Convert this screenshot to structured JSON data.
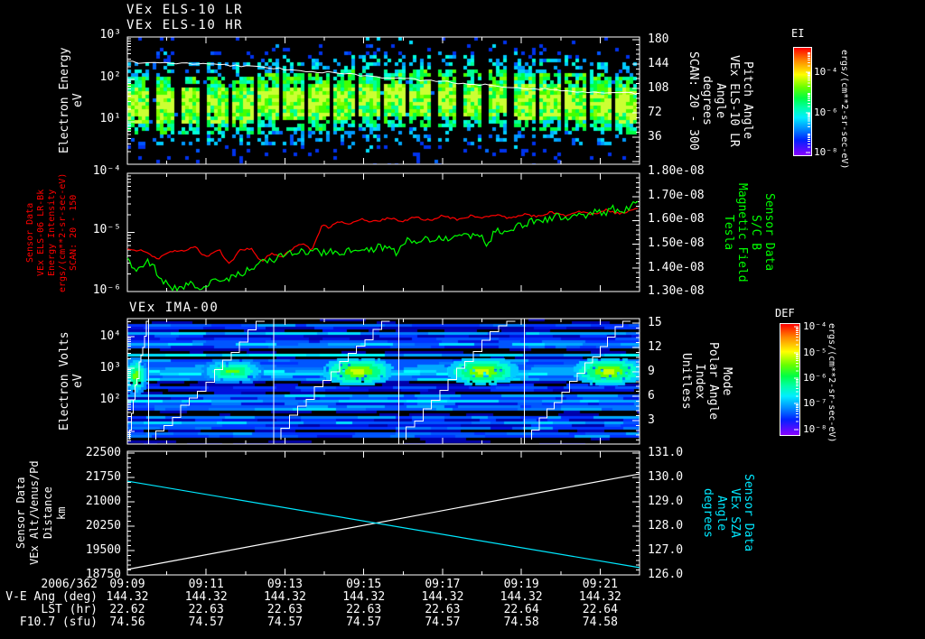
{
  "header": {
    "title_line1": "VEx ELS-10 LR",
    "title_line2": "VEx ELS-10 HR"
  },
  "panel1": {
    "left_label_lines": [
      "Electron Energy",
      "eV"
    ],
    "left_ticks": [
      "10³",
      "10²",
      "10¹"
    ],
    "right_ticks": [
      "180",
      "144",
      "108",
      "72",
      "36"
    ],
    "right_label_lines": [
      "Pitch Angle",
      "VEx ELS-10 LR",
      "Angle",
      "degrees",
      "SCAN: 20 - 300"
    ],
    "colorbar": {
      "title": "EI",
      "ticks": [
        "10⁻⁴",
        "10⁻⁶",
        "10⁻⁸"
      ],
      "units": "ergs/(cm**2-sr-sec-eV)"
    }
  },
  "panel2": {
    "left_label_lines": [
      "Sensor Data",
      "VEx ELS-06 LR-Bk",
      "Energy Intensity",
      "ergs/(cm**2-sr-sec-eV)",
      "SCAN: 20 - 150"
    ],
    "left_ticks": [
      "10⁻⁴",
      "10⁻⁵",
      "10⁻⁶"
    ],
    "right_ticks": [
      "1.80e-08",
      "1.70e-08",
      "1.60e-08",
      "1.50e-08",
      "1.40e-08",
      "1.30e-08"
    ],
    "right_label_lines": [
      "Sensor Data",
      "S/C B",
      "Magnetic Field",
      "Tesla"
    ]
  },
  "panel3": {
    "title": "VEx IMA-00",
    "left_label_lines": [
      "Electron Volts",
      "eV"
    ],
    "left_ticks": [
      "10⁴",
      "10³",
      "10²"
    ],
    "right_ticks": [
      "15",
      "12",
      "9",
      "6",
      "3"
    ],
    "right_label_lines": [
      "Mode",
      "Polar Angle",
      "Index",
      "Unitless"
    ],
    "colorbar": {
      "title": "DEF",
      "ticks": [
        "10⁻⁴",
        "10⁻⁵",
        "10⁻⁶",
        "10⁻⁷",
        "10⁻⁸"
      ],
      "units": "ergs/(cm**2-sr-sec-eV)"
    }
  },
  "panel4": {
    "left_label_lines": [
      "Sensor Data",
      "VEx Alt/Venus/Pd",
      "Distance",
      "km"
    ],
    "left_ticks": [
      "22500",
      "21750",
      "21000",
      "20250",
      "19500",
      "18750"
    ],
    "right_ticks": [
      "131.0",
      "130.0",
      "129.0",
      "128.0",
      "127.0",
      "126.0"
    ],
    "right_label_lines": [
      "Sensor Data",
      "VEx SZA",
      "Angle",
      "degrees"
    ]
  },
  "xaxis": {
    "date": "2006/362",
    "times": [
      "09:09",
      "09:11",
      "09:13",
      "09:15",
      "09:17",
      "09:19",
      "09:21"
    ]
  },
  "table": {
    "rows": [
      {
        "label": "V-E Ang (deg)",
        "values": [
          "144.32",
          "144.32",
          "144.32",
          "144.32",
          "144.32",
          "144.32",
          "144.32"
        ]
      },
      {
        "label": "LST (hr)",
        "values": [
          "22.62",
          "22.63",
          "22.63",
          "22.63",
          "22.63",
          "22.64",
          "22.64"
        ]
      },
      {
        "label": "F10.7 (sfu)",
        "values": [
          "74.56",
          "74.57",
          "74.57",
          "74.57",
          "74.57",
          "74.58",
          "74.58"
        ]
      }
    ]
  },
  "colors": {
    "background": "#000000",
    "foreground": "#ffffff",
    "red_series": "#ff0000",
    "green_series": "#00ff00",
    "cyan_series": "#00e8ff",
    "white_line": "#ffffff",
    "rainbow_stops": [
      "#ff0000 0%",
      "#ff8800 12%",
      "#ffff00 25%",
      "#66ff00 37%",
      "#00ff44 47%",
      "#00ffaa 56%",
      "#00eeff 65%",
      "#0088ff 76%",
      "#0022ff 86%",
      "#8800ff 100%"
    ]
  },
  "chart_data": [
    {
      "type": "heatmap",
      "title": "VEx ELS-10 LR / VEx ELS-10 HR",
      "ylabel": "Electron Energy (eV)",
      "y_scale": "log",
      "ylim": [
        1,
        1000
      ],
      "x_range": [
        "09:09",
        "09:22"
      ],
      "zlabel": "EI ergs/(cm**2-sr-sec-eV)",
      "zlim": [
        1e-08,
        0.0001
      ],
      "description": "Electron energy-time spectrogram made of ~20 vertical scan columns separated by black gaps; peak flux (yellow-green) band near 20-60 eV, cyan/blue scatter up to 1000 eV and down to a few eV",
      "overlay_line": {
        "name": "pitch angle (deg, right axis 0-180)",
        "t_minutes": [
          0,
          1.35,
          2.5,
          3.65,
          4.79,
          5.94,
          7.08,
          8.23,
          9.38,
          10.52,
          11.67,
          13
        ],
        "values": [
          147,
          145,
          143,
          138,
          133,
          127,
          122,
          117,
          112,
          107,
          103,
          100
        ]
      }
    },
    {
      "type": "line",
      "x_range": [
        "09:09",
        "09:22"
      ],
      "series": [
        {
          "name": "VEx ELS-06 LR-Bk Energy Intensity ergs/(cm**2-sr-sec-eV) SCAN: 20 - 150",
          "color": "#ff0000",
          "axis": "left",
          "y_scale": "log",
          "ylim": [
            1e-06,
            0.0001
          ],
          "t_minutes": [
            0,
            0.44,
            0.78,
            1.08,
            1.47,
            1.7,
            2,
            2.32,
            2.59,
            2.84,
            3.14,
            3.42,
            3.65,
            3.92,
            4.15,
            4.45,
            4.68,
            4.84,
            4.97,
            5.13,
            5.3,
            5.59,
            5.94,
            6.28,
            6.63,
            6.97,
            7.31,
            7.66,
            8,
            8.34,
            8.69,
            9.03,
            9.38,
            9.72,
            10.06,
            10.41,
            10.75,
            11.1,
            11.44,
            11.78,
            12.13,
            12.47,
            12.82,
            13
          ],
          "log10_values": [
            -5.28,
            -5.32,
            -5.45,
            -5.33,
            -5.3,
            -5.24,
            -5.42,
            -5.28,
            -5.55,
            -5.3,
            -5.28,
            -5.5,
            -5.35,
            -5.42,
            -5.3,
            -5.17,
            -5.3,
            -5.05,
            -4.85,
            -4.95,
            -4.82,
            -4.85,
            -4.78,
            -4.82,
            -4.75,
            -4.82,
            -4.74,
            -4.8,
            -4.72,
            -4.78,
            -4.72,
            -4.76,
            -4.7,
            -4.76,
            -4.7,
            -4.73,
            -4.66,
            -4.72,
            -4.64,
            -4.7,
            -4.62,
            -4.68,
            -4.62,
            -4.6
          ]
        },
        {
          "name": "S/C B Magnetic Field (Tesla)",
          "color": "#00ff00",
          "axis": "right",
          "ylim": [
            1.3e-08,
            1.8e-08
          ],
          "t_start": 0,
          "t_end": 13,
          "values_e8": [
            1.43,
            1.38,
            1.43,
            1.4,
            1.34,
            1.32,
            1.31,
            1.34,
            1.32,
            1.33,
            1.36,
            1.35,
            1.37,
            1.38,
            1.4,
            1.42,
            1.43,
            1.45,
            1.46,
            1.47,
            1.46,
            1.475,
            1.46,
            1.475,
            1.465,
            1.475,
            1.48,
            1.475,
            1.49,
            1.48,
            1.46,
            1.52,
            1.5,
            1.52,
            1.51,
            1.53,
            1.52,
            1.54,
            1.53,
            1.55,
            1.5,
            1.56,
            1.55,
            1.57,
            1.58,
            1.6,
            1.59,
            1.61,
            1.62,
            1.6,
            1.63,
            1.62,
            1.64,
            1.63,
            1.65,
            1.64,
            1.66,
            1.68
          ]
        }
      ]
    },
    {
      "type": "heatmap",
      "title": "VEx IMA-00",
      "ylabel": "Electron Volts (eV)",
      "y_scale": "log",
      "ylim_log10": [
        0.6,
        4.57
      ],
      "x_range": [
        "09:09",
        "09:22"
      ],
      "zlabel": "DEF ergs/(cm**2-sr-sec-eV)",
      "zlim": [
        1e-08,
        0.0001
      ],
      "cycle_minutes": 3.18,
      "description": "Ion energy-time spectrogram of horizontal blue banded rows with black gaps; bright green/yellow blob near 400-1000 eV recurring in each ~3.2 min scan cycle; white polar-angle staircase rises across each cycle; vertical white lines at cycle boundaries",
      "overlay_line": {
        "name": "Mode / Polar Angle staircase (right axis 0-15)"
      }
    },
    {
      "type": "line",
      "x_range": [
        "09:09",
        "09:22"
      ],
      "series": [
        {
          "name": "VEx Alt/Venus/Pd Distance (km)",
          "color": "#ffffff",
          "axis": "left",
          "ylim": [
            18750,
            22500
          ],
          "t_minutes": [
            0,
            13
          ],
          "values": [
            18920,
            21860
          ]
        },
        {
          "name": "VEx SZA Angle (degrees)",
          "color": "#00e8ff",
          "axis": "right",
          "ylim": [
            126.0,
            131.0
          ],
          "t_minutes": [
            0,
            13
          ],
          "values": [
            129.85,
            126.3
          ]
        }
      ]
    }
  ]
}
